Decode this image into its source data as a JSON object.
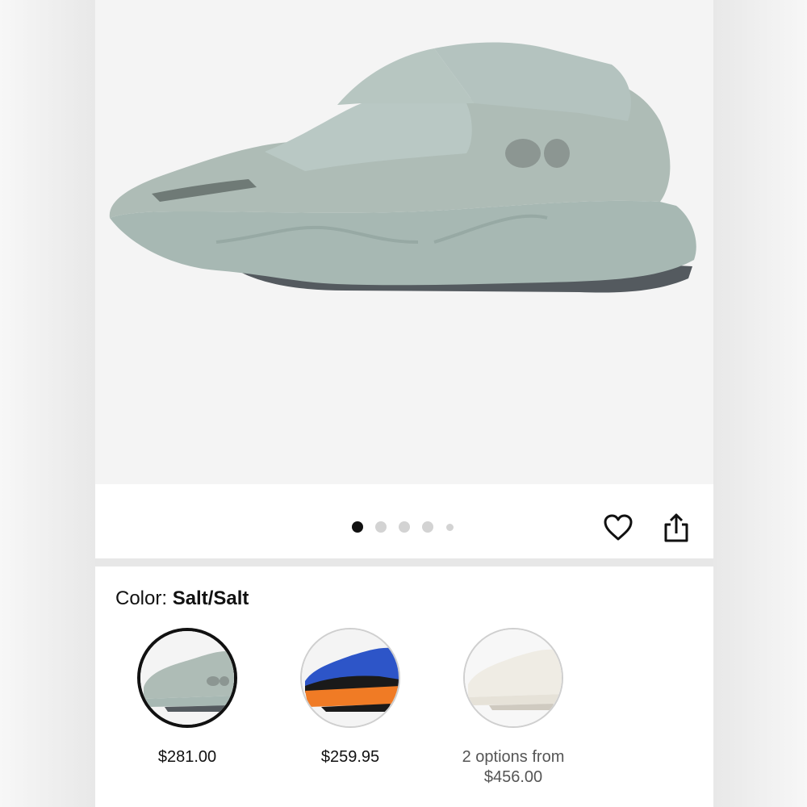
{
  "product": {
    "image_alt": "Salt/Salt sneaker product photo",
    "colors": {
      "upper": "#aebcb6",
      "mesh": "#b9c8c4",
      "sole": "#a7b8b3",
      "outsole": "#545a5f",
      "background": "#f4f4f4"
    }
  },
  "gallery": {
    "page_count": 5,
    "active_index": 0
  },
  "actions": {
    "wishlist_icon": "heart-icon",
    "share_icon": "share-icon"
  },
  "color_selector": {
    "label": "Color:",
    "selected": "Salt/Salt",
    "options": [
      {
        "name": "Salt/Salt",
        "price_lines": [
          "$281.00"
        ],
        "selected": true,
        "palette": [
          "#aebcb6",
          "#545a5f"
        ]
      },
      {
        "name": "Blue/Orange",
        "price_lines": [
          "$259.95"
        ],
        "selected": false,
        "palette": [
          "#2d55c8",
          "#f07b25",
          "#1a1a1a"
        ]
      },
      {
        "name": "Cream",
        "price_lines": [
          "2 options from",
          "$456.00"
        ],
        "selected": false,
        "palette": [
          "#efece4",
          "#cfcac0"
        ]
      }
    ]
  }
}
